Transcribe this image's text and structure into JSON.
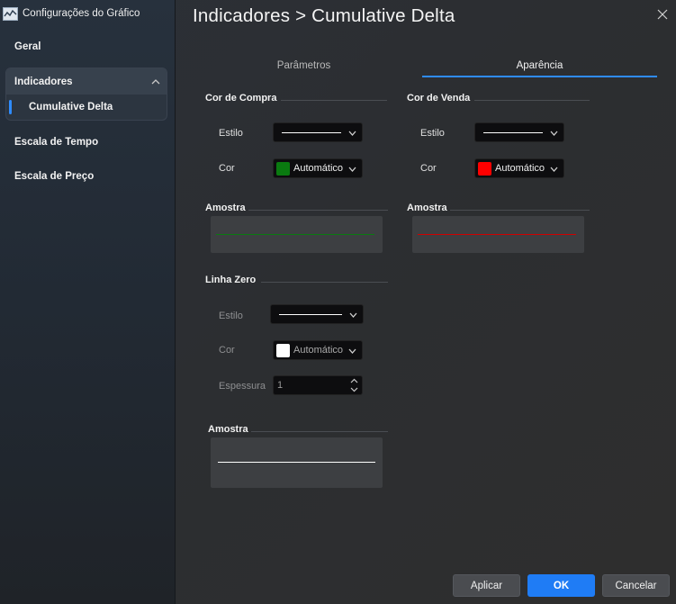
{
  "app": {
    "title": "Configurações do Gráfico",
    "page_title": "Indicadores > Cumulative Delta"
  },
  "sidebar": {
    "items": [
      {
        "label": "Geral"
      },
      {
        "label": "Indicadores",
        "expanded": true,
        "children": [
          {
            "label": "Cumulative Delta",
            "selected": true
          }
        ]
      },
      {
        "label": "Escala de Tempo"
      },
      {
        "label": "Escala de Preço"
      }
    ]
  },
  "tabs": [
    {
      "label": "Parâmetros",
      "active": false
    },
    {
      "label": "Aparência",
      "active": true
    }
  ],
  "compra": {
    "title": "Cor de Compra",
    "estilo_label": "Estilo",
    "cor_label": "Cor",
    "cor_value": "Automático",
    "color": "#0a7a10",
    "amostra_label": "Amostra"
  },
  "venda": {
    "title": "Cor de Venda",
    "estilo_label": "Estilo",
    "cor_label": "Cor",
    "cor_value": "Automático",
    "color": "#ff0000",
    "amostra_label": "Amostra"
  },
  "linha_zero": {
    "title": "Linha Zero",
    "estilo_label": "Estilo",
    "cor_label": "Cor",
    "cor_value": "Automático",
    "color": "#ffffff",
    "espessura_label": "Espessura",
    "espessura_value": "1",
    "amostra_label": "Amostra"
  },
  "buttons": {
    "apply": "Aplicar",
    "ok": "OK",
    "cancel": "Cancelar"
  },
  "colors": {
    "accent": "#2f8cff",
    "primary_button": "#1f7cf5"
  }
}
